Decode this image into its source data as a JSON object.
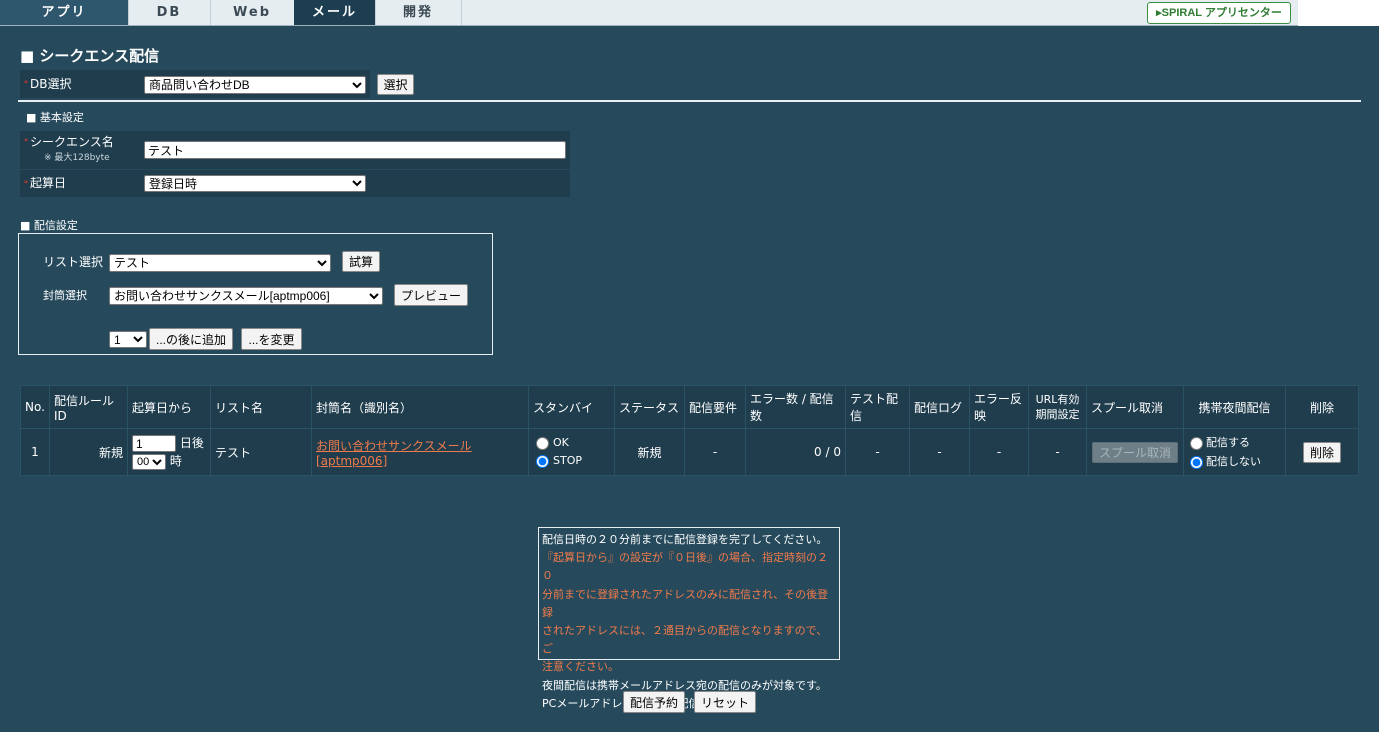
{
  "nav": {
    "tabs": [
      "アプリ",
      "DB",
      "Web",
      "メール",
      "開発"
    ],
    "logo": "▸SPIRAL アプリセンター"
  },
  "page_title": "■ シークエンス配信",
  "db_select": {
    "label": "DB選択",
    "value": "商品問い合わせDB",
    "button": "選択"
  },
  "basic": {
    "heading": "■ 基本設定",
    "sequence_name_label": "シークエンス名",
    "sequence_name_note": "※ 最大128byte",
    "sequence_name_value": "テスト",
    "base_date_label": "起算日",
    "base_date_value": "登録日時"
  },
  "distribution": {
    "heading": "■ 配信設定",
    "list_label": "リスト選択",
    "list_value": "テスト",
    "calc_button": "試算",
    "envelope_label": "封筒選択",
    "envelope_value": "お問い合わせサンクスメール[aptmp006]",
    "preview_button": "プレビュー",
    "position_value": "1",
    "add_after_button": "...の後に追加",
    "change_button": "...を変更"
  },
  "table": {
    "headers": [
      "No.",
      "配信ルールID",
      "起算日から",
      "リスト名",
      "封筒名（識別名）",
      "スタンバイ",
      "ステータス",
      "配信要件",
      "エラー数 / 配信数",
      "テスト配信",
      "配信ログ",
      "エラー反映",
      "URL有効期間設定",
      "スプール取消",
      "携帯夜間配信",
      "削除"
    ],
    "url_header_line1": "URL有効",
    "url_header_line2": "期間設定",
    "row": {
      "no": "1",
      "rule_id": "新規",
      "days_value": "1",
      "days_unit": "日後",
      "hour_value": "00",
      "hour_unit": "時",
      "list_name": "テスト",
      "envelope": "お問い合わせサンクスメール[aptmp006]",
      "standby_ok": "OK",
      "standby_stop": "STOP",
      "status": "新規",
      "requirement": "-",
      "error_count": "0 / 0",
      "test": "-",
      "log": "-",
      "error_reflect": "-",
      "url_period": "-",
      "spool_cancel": "スプール取消",
      "night_yes": "配信する",
      "night_no": "配信しない",
      "delete": "削除"
    }
  },
  "notice": {
    "line1": "配信日時の２０分前までに配信登録を完了してください。",
    "warn1": "『起算日から』の設定が『０日後』の場合、指定時刻の２０",
    "warn2": "分前までに登録されたアドレスのみに配信され、その後登録",
    "warn3": "されたアドレスには、２通目からの配信となりますので、ご",
    "warn4": "注意ください。",
    "line2": "夜間配信は携帯メールアドレス宛の配信のみが対象です。",
    "line3": "PCメールアドレスは夜間も配信されます。"
  },
  "footer": {
    "reserve_button": "配信予約",
    "reset_button": "リセット"
  },
  "colors": {
    "background": "#264a5c",
    "cell": "#1f3d4d",
    "link": "#f07a4a",
    "required": "#e23a2a"
  }
}
